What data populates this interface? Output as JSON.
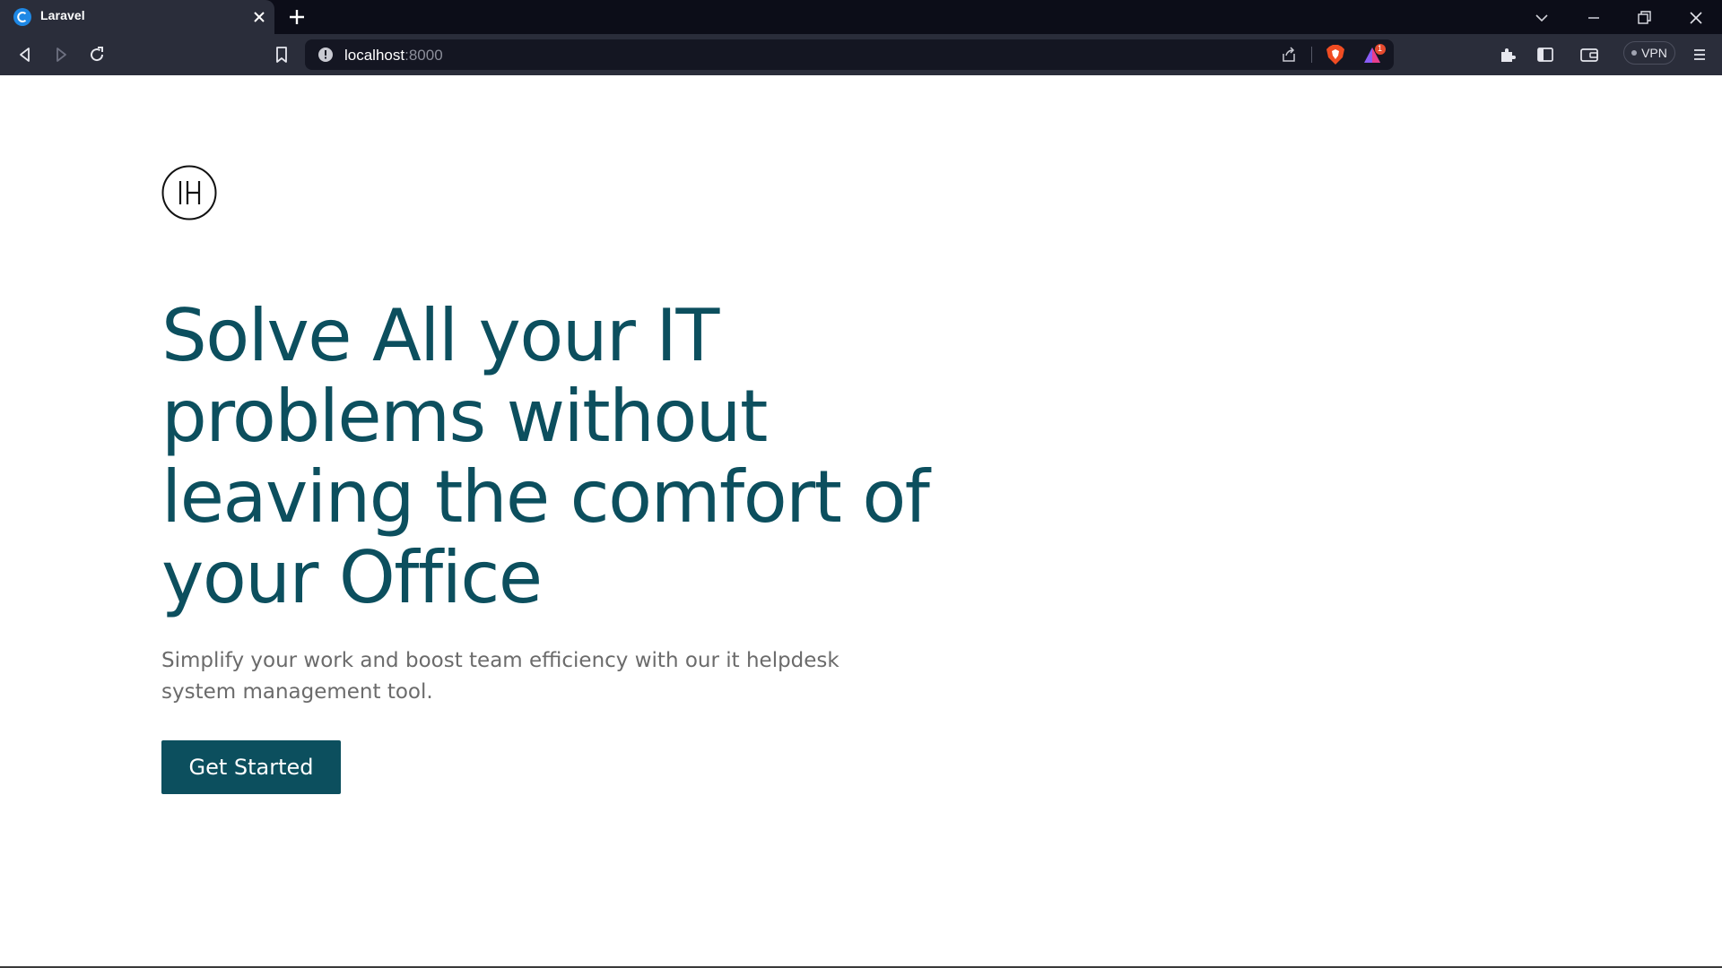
{
  "browser": {
    "tab_title": "Laravel",
    "url_host": "localhost",
    "url_port": ":8000",
    "vpn_label": "VPN",
    "rewards_badge": "1"
  },
  "page": {
    "logo_text": "IH",
    "headline": "Solve All your IT problems without leaving the comfort of your Office",
    "subtext": "Simplify your work and boost team efficiency with our it helpdesk system management tool.",
    "cta_label": "Get Started"
  },
  "colors": {
    "brand_teal": "#0c4f5e",
    "chrome_dark": "#0c0d18",
    "toolbar": "#2a2d3a"
  }
}
